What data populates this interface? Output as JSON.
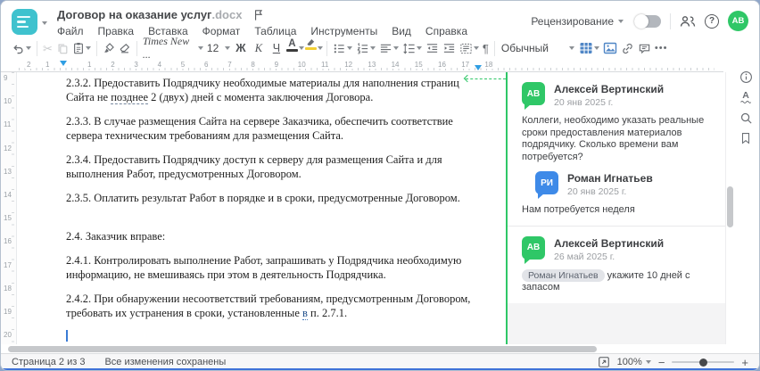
{
  "window": {
    "title": "Договор на оказание услуг",
    "title_ext": ".docx"
  },
  "menu": {
    "items": [
      "Файл",
      "Правка",
      "Вставка",
      "Формат",
      "Таблица",
      "Инструменты",
      "Вид",
      "Справка"
    ]
  },
  "header_right": {
    "review_label": "Рецензирование",
    "help_glyph": "?",
    "avatar_initials": "АВ"
  },
  "icons": {
    "cut_glyph": "✂",
    "more_glyph": "•••"
  },
  "toolbar": {
    "font_name": "Times New ...",
    "font_size": "12",
    "bold_label": "Ж",
    "italic_label": "К",
    "underline_label": "Ч",
    "font_color_label": "А",
    "spellcheck_letter": "А",
    "pilcrow": "¶",
    "style_name": "Обычный"
  },
  "ruler": {
    "left_numbers": [
      "2",
      "1"
    ],
    "numbers": [
      "1",
      "2",
      "3",
      "4",
      "5",
      "6",
      "7",
      "8",
      "9",
      "10",
      "11",
      "12",
      "13",
      "14",
      "15",
      "16",
      "17",
      "18"
    ],
    "vertical_numbers": [
      "9",
      "10",
      "11",
      "12",
      "13",
      "14",
      "15",
      "16",
      "17",
      "18",
      "19",
      "20"
    ]
  },
  "document": {
    "paragraphs": [
      {
        "segments": [
          {
            "t": "2.3.2. Предоставить Подрядчику необходимые материалы для наполнения страниц Сайта не "
          },
          {
            "t": "позднее",
            "mark": "dashed"
          },
          {
            "t": " 2 (двух) дней с момента заключения Договора."
          }
        ]
      },
      {
        "segments": [
          {
            "t": "2.3.3. В случае размещения Сайта на сервере Заказчика, обеспечить соответствие сервера техническим требованиям для размещения Сайта."
          }
        ]
      },
      {
        "segments": [
          {
            "t": "2.3.4. Предоставить Подрядчику доступ к серверу для размещения Сайта и для выполнения Работ, предусмотренных Договором."
          }
        ]
      },
      {
        "segments": [
          {
            "t": "2.3.5. Оплатить результат Работ в порядке и в сроки, предусмотренные Договором."
          }
        ]
      },
      {
        "segments": [
          {
            "t": ""
          }
        ],
        "empty": true
      },
      {
        "segments": [
          {
            "t": "2.4. Заказчик вправе:"
          }
        ]
      },
      {
        "segments": [
          {
            "t": "2.4.1. Контролировать выполнение Работ, запрашивать у Подрядчика необходимую информацию, не вмешиваясь при этом в деятельность Подрядчика."
          }
        ]
      },
      {
        "segments": [
          {
            "t": "2.4.2. При обнаружении несоответствий требованиям, предусмотренным Договором, требовать их устранения в сроки, установленные "
          },
          {
            "t": "в",
            "mark": "dotted"
          },
          {
            "t": " п. 2.7.1."
          }
        ]
      }
    ]
  },
  "comments_panel": {
    "threads": [
      {
        "comments": [
          {
            "initials": "АВ",
            "color": "#2fc767",
            "name": "Алексей Вертинский",
            "date": "20 янв 2025 г.",
            "text": "Коллеги, необходимо указать реальные сроки предоставления материалов подрядчику. Сколько времени вам потребуется?",
            "reply": false
          },
          {
            "initials": "РИ",
            "color": "#3e8ae8",
            "name": "Роман Игнатьев",
            "date": "20 янв 2025 г.",
            "text": "Нам потребуется неделя",
            "reply": true
          }
        ]
      },
      {
        "comments": [
          {
            "initials": "АВ",
            "color": "#2fc767",
            "name": "Алексей Вертинский",
            "date": "26 май 2025 г.",
            "mention": "Роман Игнатьев",
            "text": "укажите 10 дней с запасом",
            "reply": false
          }
        ]
      }
    ]
  },
  "status_bar": {
    "page_label": "Страница 2 из 3",
    "saved_label": "Все изменения сохранены",
    "zoom_value": "100%",
    "zoom_out": "−",
    "zoom_in": "+"
  },
  "colors": {
    "brand_teal": "#3fc2ce",
    "accent_green": "#2fc767",
    "accent_blue": "#3e8ae8",
    "toolbar_icon_blue": "#4f86c6",
    "ruler_marker_blue": "#2f9ee3"
  }
}
